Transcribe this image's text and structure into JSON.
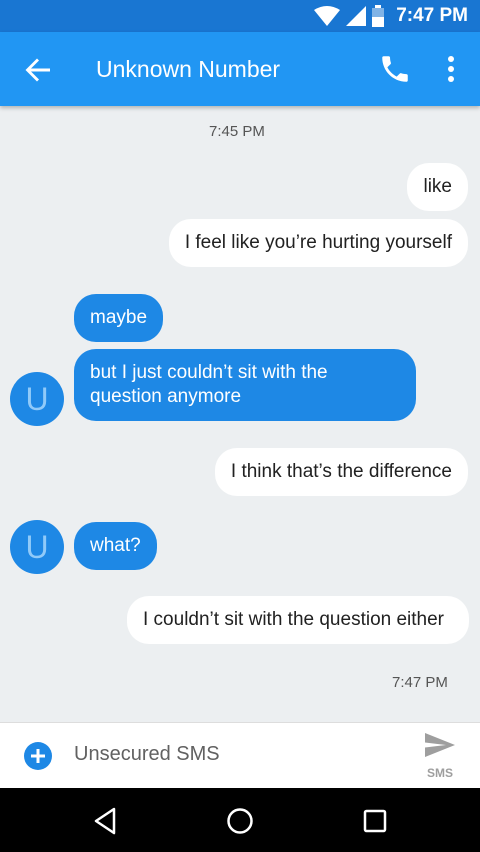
{
  "status_bar": {
    "time": "7:47 PM"
  },
  "app_bar": {
    "title": "Unknown Number"
  },
  "conversation": {
    "timestamp_top": "7:45 PM",
    "messages": [
      {
        "direction": "out",
        "text": "like"
      },
      {
        "direction": "out",
        "text": "I feel like you’re hurting yourself"
      },
      {
        "direction": "in",
        "text": "maybe"
      },
      {
        "direction": "in",
        "text": "but I just couldn’t sit with the question anymore"
      },
      {
        "direction": "out",
        "text": "I think that’s the difference"
      },
      {
        "direction": "in",
        "text": "what?"
      },
      {
        "direction": "out",
        "text": "I couldn’t sit with the question either"
      }
    ],
    "avatar_letter": "U",
    "timestamp_bottom": "7:47 PM"
  },
  "compose": {
    "placeholder": "Unsecured SMS",
    "send_label": "SMS"
  },
  "colors": {
    "primary": "#2196f3",
    "primary_dark": "#1976d2",
    "incoming_bubble": "#1e88e5",
    "outgoing_bubble": "#ffffff"
  },
  "icons": [
    "wifi-icon",
    "signal-icon",
    "battery-icon",
    "back-arrow-icon",
    "phone-icon",
    "more-vert-icon",
    "add-icon",
    "send-icon",
    "nav-back-icon",
    "nav-home-icon",
    "nav-recents-icon"
  ]
}
